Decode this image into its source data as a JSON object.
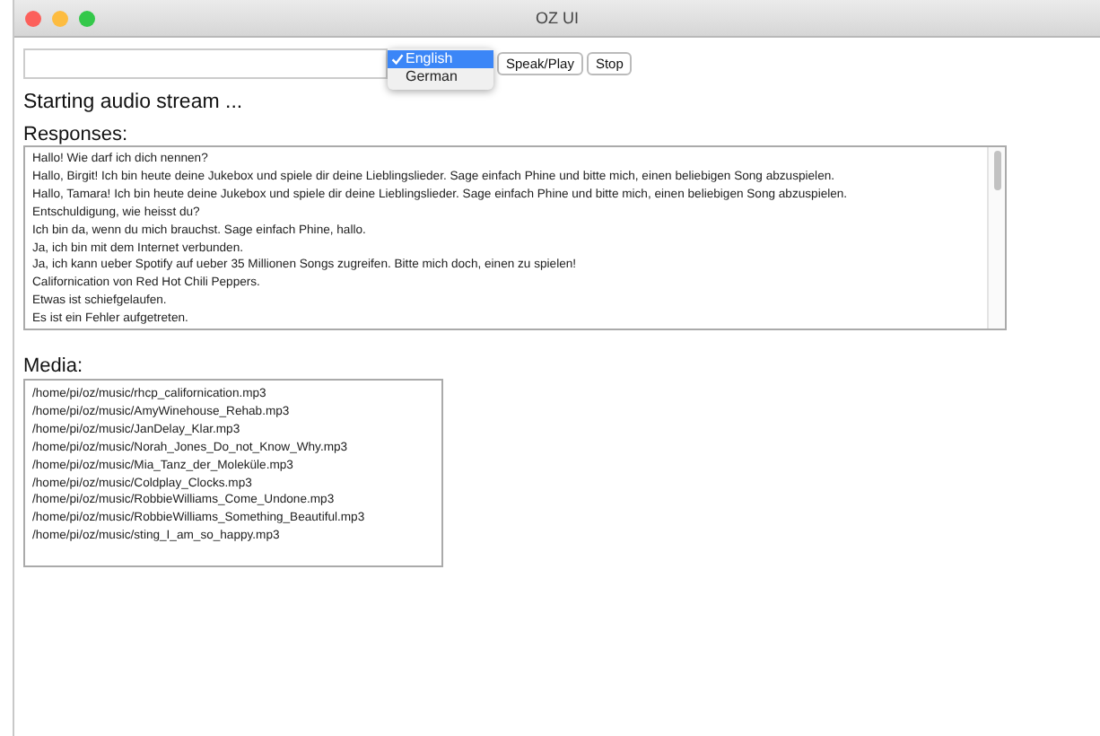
{
  "window": {
    "title": "OZ UI"
  },
  "language_menu": {
    "items": [
      {
        "label": "English",
        "selected": true
      },
      {
        "label": "German",
        "selected": false
      }
    ]
  },
  "buttons": [
    "Speak/Play",
    "Stop"
  ],
  "status": "Starting audio stream ...",
  "responses": {
    "label": "Responses:",
    "lines": [
      "Hallo! Wie darf ich dich nennen?",
      "Hallo, Birgit! Ich bin heute deine Jukebox und spiele dir deine Lieblingslieder. Sage einfach Phine und bitte mich, einen beliebigen Song abzuspielen.",
      "Hallo, Tamara! Ich bin heute deine Jukebox und spiele dir deine Lieblingslieder. Sage einfach Phine und bitte mich, einen beliebigen Song abzuspielen.",
      "Entschuldigung, wie heisst du?",
      "Ich bin da, wenn du mich brauchst. Sage einfach Phine, hallo.",
      "Ja, ich bin mit dem Internet verbunden.",
      "Ja, ich kann ueber Spotify auf ueber 35 Millionen Songs zugreifen. Bitte mich doch, einen zu spielen!",
      "Californication von Red Hot Chili Peppers.",
      "Etwas ist schiefgelaufen.",
      "Es ist ein Fehler aufgetreten."
    ]
  },
  "media": {
    "label": "Media:",
    "items": [
      "/home/pi/oz/music/rhcp_californication.mp3",
      "/home/pi/oz/music/AmyWinehouse_Rehab.mp3",
      "/home/pi/oz/music/JanDelay_Klar.mp3",
      "/home/pi/oz/music/Norah_Jones_Do_not_Know_Why.mp3",
      "/home/pi/oz/music/Mia_Tanz_der_Moleküle.mp3",
      "/home/pi/oz/music/Coldplay_Clocks.mp3",
      "/home/pi/oz/music/RobbieWilliams_Come_Undone.mp3",
      "/home/pi/oz/music/RobbieWilliams_Something_Beautiful.mp3",
      "/home/pi/oz/music/sting_I_am_so_happy.mp3"
    ]
  }
}
